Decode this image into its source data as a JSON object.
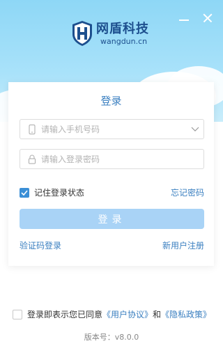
{
  "brand": {
    "name_cn": "网盾科技",
    "name_en": "wangdun.cn",
    "color": "#1d4f8e",
    "mark_letter": "H"
  },
  "window": {
    "minimize_icon": "minimize-icon",
    "close_icon": "close-icon"
  },
  "login": {
    "title": "登录",
    "phone": {
      "placeholder": "请输入手机号码",
      "value": "",
      "icon": "phone-icon"
    },
    "password": {
      "placeholder": "请输入登录密码",
      "value": "",
      "icon": "lock-icon"
    },
    "remember_label": "记住登录状态",
    "remember_checked": true,
    "forgot_label": "忘记密码",
    "submit_label": "登录",
    "sms_login_label": "验证码登录",
    "register_label": "新用户注册"
  },
  "agreement": {
    "prefix": "登录即表示您已同意",
    "user_agreement": "《用户协议》",
    "conjunction": "和",
    "privacy_policy": "《隐私政策》",
    "checked": false
  },
  "version_text": "版本号：v8.0.0",
  "colors": {
    "accent": "#3a7fc0",
    "button_disabled": "#a9d3f6",
    "checkbox": "#3b8fd6",
    "sky": "#8ed7f6"
  }
}
